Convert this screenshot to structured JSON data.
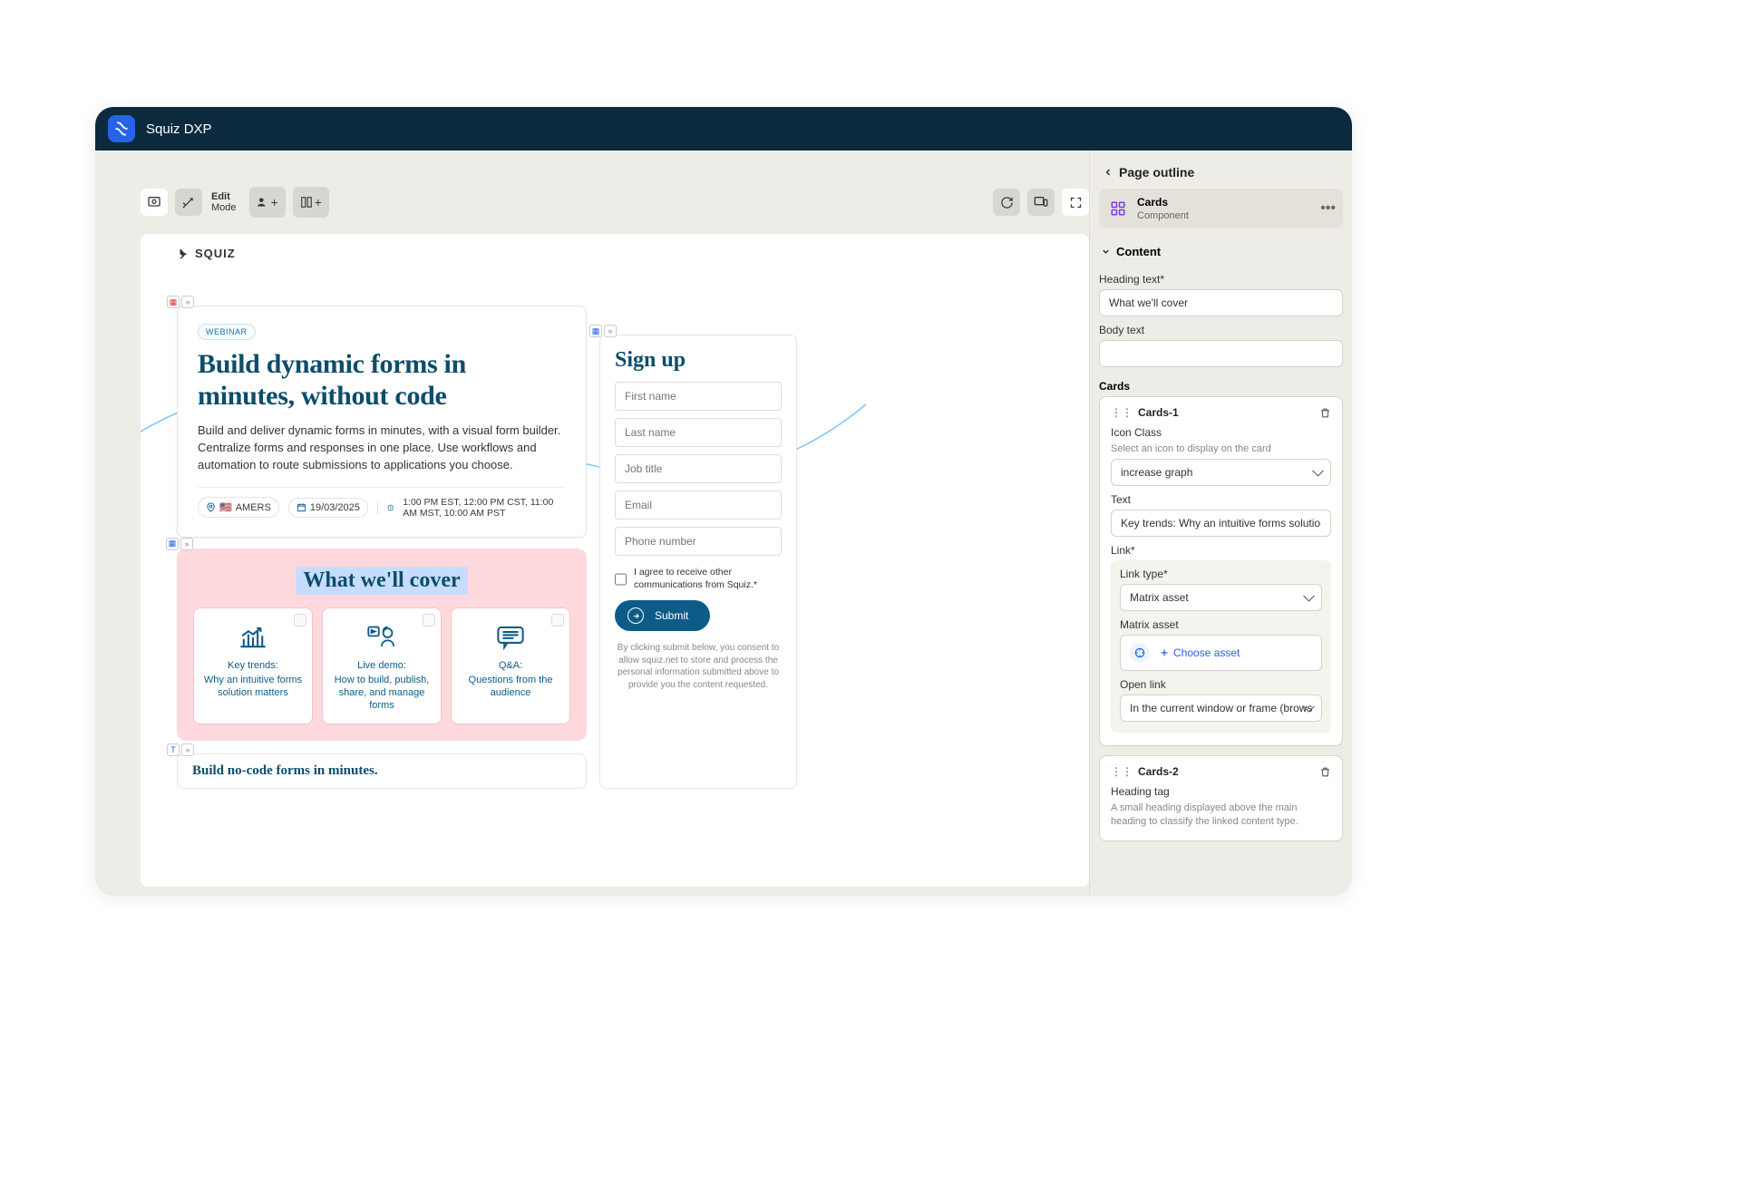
{
  "topbar": {
    "title": "Squiz DXP"
  },
  "toolbar": {
    "mode_l1": "Edit",
    "mode_l2": "Mode"
  },
  "page": {
    "brand": "SQUIZ",
    "hero": {
      "badge": "WEBINAR",
      "title": "Build dynamic forms in minutes, without code",
      "lede": "Build and deliver dynamic forms in minutes, with a visual form builder. Centralize forms and responses in one place. Use workflows and automation to route submissions to applications you choose.",
      "region": "AMERS",
      "date": "19/03/2025",
      "times": "1:00 PM EST,  12:00 PM CST,  11:00 AM MST,  10:00 AM PST"
    },
    "cover": {
      "title": "What we'll cover",
      "cards": [
        {
          "t1": "Key trends:",
          "t2": "Why an intuitive forms solution matters"
        },
        {
          "t1": "Live demo:",
          "t2": "How to build, publish, share, and manage forms"
        },
        {
          "t1": "Q&A:",
          "t2": "Questions from the audience"
        }
      ]
    },
    "nocode": "Build no-code forms in minutes.",
    "signup": {
      "title": "Sign up",
      "fields": [
        "First name",
        "Last name",
        "Job title",
        "Email",
        "Phone number"
      ],
      "consent": "I agree to receive other communications from Squiz.*",
      "submit": "Submit",
      "fine": "By clicking submit below, you consent to allow squiz.net to store and process the personal information submitted above to provide you the content requested."
    }
  },
  "outline": {
    "title": "Page outline",
    "component": {
      "name": "Cards",
      "sub": "Component"
    },
    "content_section": "Content",
    "heading_label": "Heading text*",
    "heading_value": "What we'll cover",
    "body_label": "Body text",
    "body_value": "",
    "cards_label": "Cards",
    "card1": {
      "name": "Cards-1",
      "iconclass_label": "Icon Class",
      "iconclass_hint": "Select an icon to display on the card",
      "iconclass_value": "increase graph",
      "text_label": "Text",
      "text_value": "Key trends: Why an intuitive forms solution matters",
      "link_label": "Link*",
      "linktype_label": "Link type*",
      "linktype_value": "Matrix asset",
      "matrixasset_label": "Matrix asset",
      "choose_asset": "Choose asset",
      "openlink_label": "Open link",
      "openlink_value": "In the current window or frame (browser"
    },
    "card2": {
      "name": "Cards-2",
      "headingtag_label": "Heading tag",
      "headingtag_hint": "A small heading displayed above the main heading to classify the linked content type."
    }
  }
}
